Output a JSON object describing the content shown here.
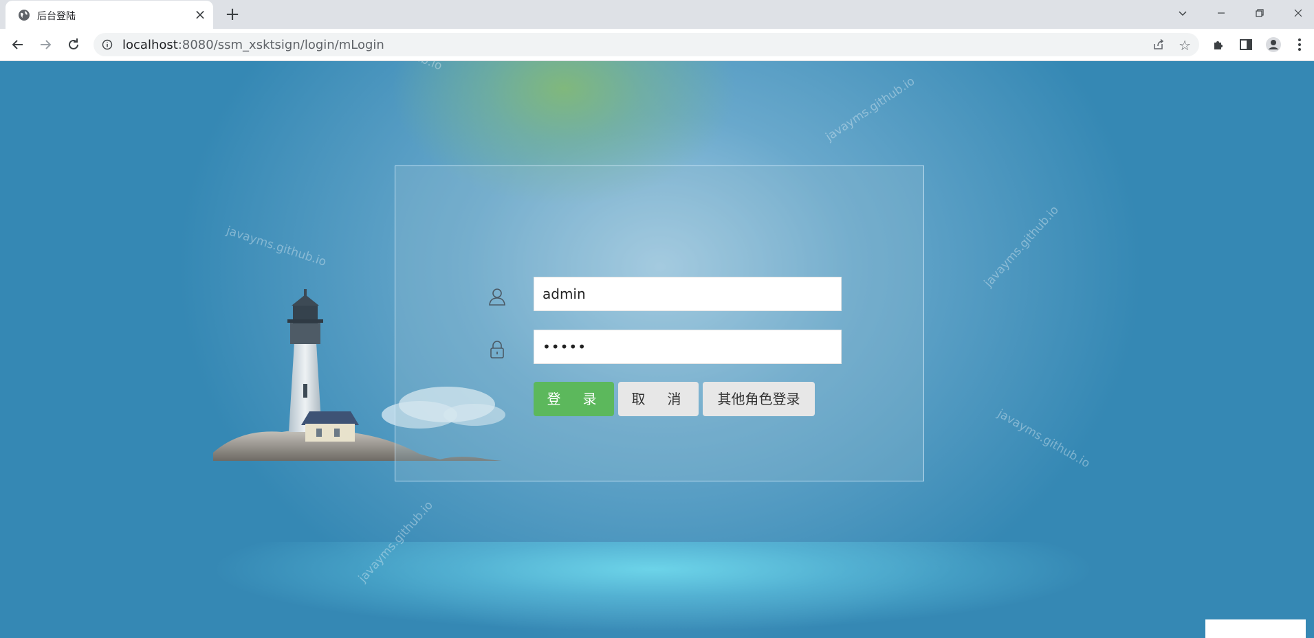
{
  "browser": {
    "tab_title": "后台登陆",
    "url_host": "localhost",
    "url_rest": ":8080/ssm_xsktsign/login/mLogin"
  },
  "login": {
    "username_value": "admin",
    "password_value": "•••••",
    "login_button": "登　录",
    "cancel_button": "取　消",
    "other_role_button": "其他角色登录"
  },
  "watermark_text": "javayms.github.io",
  "colors": {
    "login_green": "#5cb85c",
    "page_blue": "#3588b4",
    "button_gray": "#e7e7e7"
  }
}
